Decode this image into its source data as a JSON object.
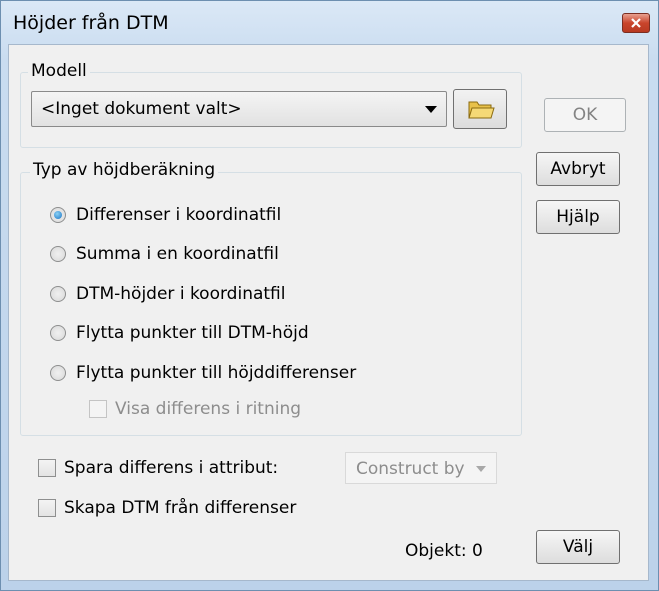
{
  "window": {
    "title": "Höjder från DTM"
  },
  "modell": {
    "label": "Modell",
    "selected": "<Inget dokument valt>"
  },
  "buttons": {
    "ok": "OK",
    "cancel": "Avbryt",
    "help": "Hjälp",
    "select": "Välj"
  },
  "calc": {
    "label": "Typ av höjdberäkning",
    "options": [
      {
        "label": "Differenser i koordinatfil",
        "checked": true
      },
      {
        "label": "Summa i en koordinatfil",
        "checked": false
      },
      {
        "label": "DTM-höjder i koordinatfil",
        "checked": false
      },
      {
        "label": "Flytta punkter till DTM-höjd",
        "checked": false
      },
      {
        "label": "Flytta punkter till höjddifferenser",
        "checked": false
      }
    ],
    "show_diff": "Visa differens i ritning"
  },
  "save_diff": {
    "label": "Spara differens i attribut:",
    "dropdown": "Construct by"
  },
  "create_dtm": {
    "label": "Skapa DTM från differenser"
  },
  "object_count": "Objekt: 0"
}
